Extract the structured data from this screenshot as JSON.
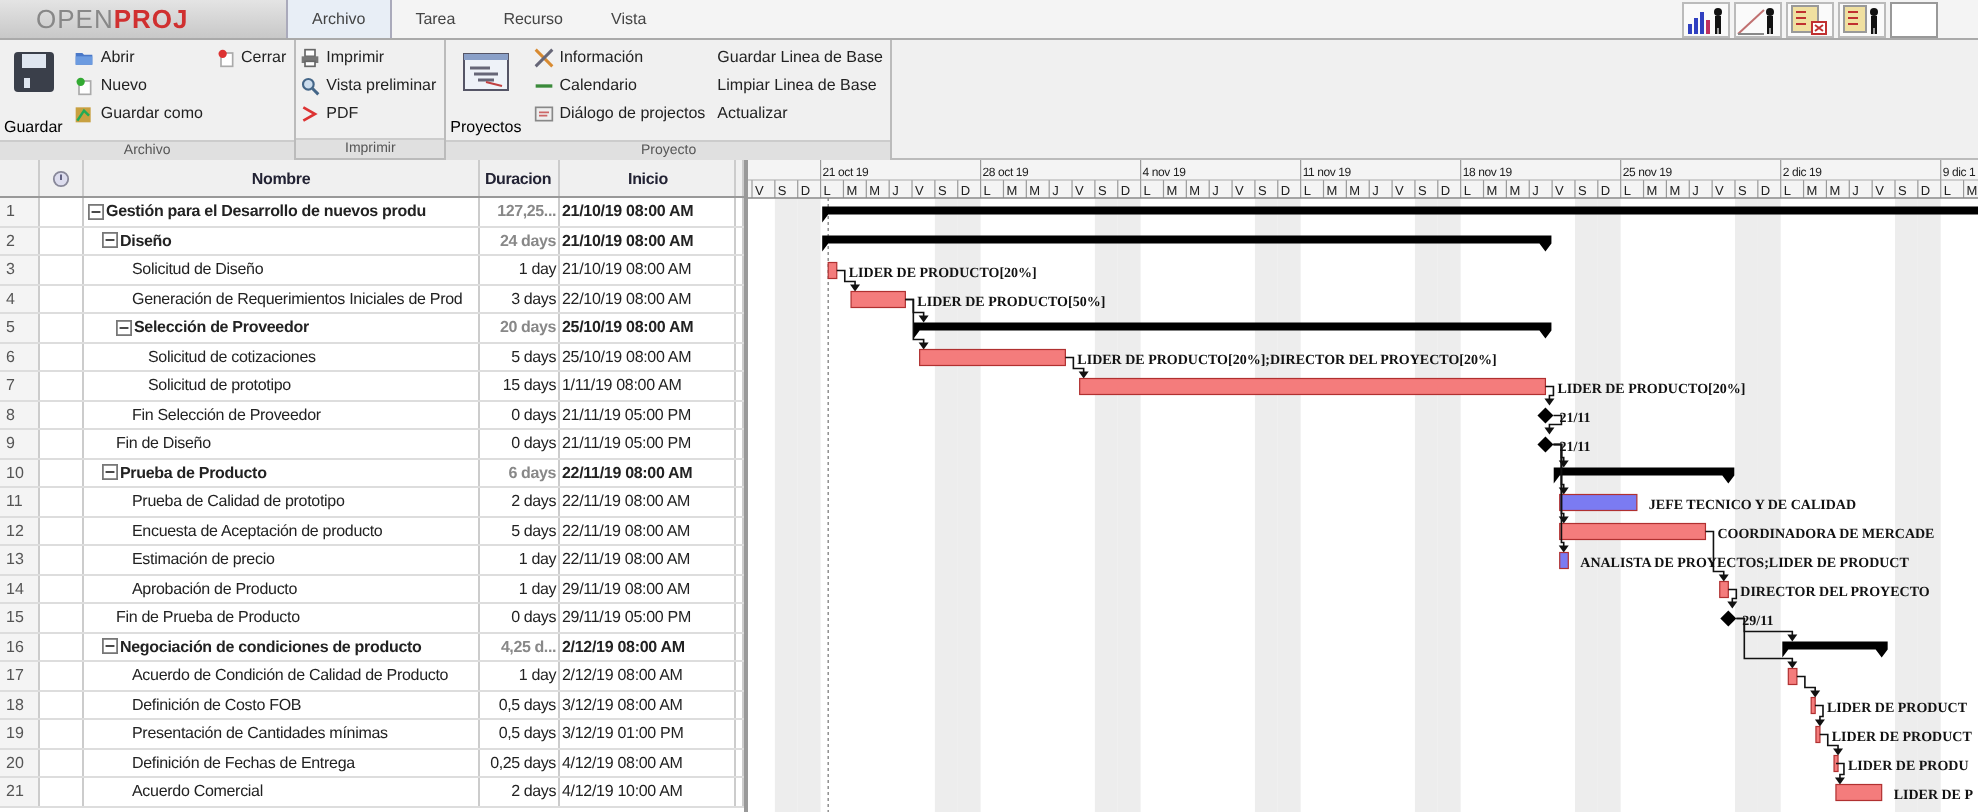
{
  "logo": {
    "part_1": "OPEN",
    "part_2": "PROJ"
  },
  "tabs": [
    {
      "label": "Archivo",
      "selected": true
    },
    {
      "label": "Tarea",
      "selected": false
    },
    {
      "label": "Recurso",
      "selected": false
    },
    {
      "label": "Vista",
      "selected": false
    }
  ],
  "ribbon": [
    {
      "label": "Archivo",
      "columns": [
        [
          {
            "label": "Guardar",
            "kind": "large"
          }
        ],
        [
          {
            "label": "Abrir",
            "kind": "small"
          },
          {
            "label": "Nuevo",
            "kind": "small"
          },
          {
            "label": "Guardar como",
            "kind": "small"
          }
        ],
        [
          {
            "label": "Cerrar",
            "kind": "small"
          }
        ]
      ]
    },
    {
      "label": "Imprimir",
      "columns": [
        [
          {
            "label": "Imprimir",
            "kind": "small"
          },
          {
            "label": "Vista preliminar",
            "kind": "small"
          },
          {
            "label": "PDF",
            "kind": "small"
          }
        ]
      ]
    },
    {
      "label": "Proyecto",
      "columns": [
        [
          {
            "label": "Proyectos",
            "kind": "large"
          }
        ],
        [
          {
            "label": "Información",
            "kind": "small"
          },
          {
            "label": "Calendario",
            "kind": "small"
          },
          {
            "label": "Diálogo de projectos",
            "kind": "small"
          }
        ],
        [
          {
            "label": "Guardar Linea de Base",
            "kind": "small"
          },
          {
            "label": "Limpiar Linea de Base",
            "kind": "small"
          },
          {
            "label": "Actualizar",
            "kind": "small"
          }
        ]
      ]
    }
  ],
  "table": {
    "columns": [
      "Nombre",
      "Duracion",
      "Inicio"
    ]
  },
  "tasks": [
    {
      "num": "1",
      "name": "Gestión para el Desarrollo de nuevos produ",
      "duration": "127,25...",
      "start": "21/10/19 08:00 AM",
      "expanded": true,
      "bar": {
        "kind": "summary"
      },
      "children": [
        {
          "num": "2",
          "name": "Diseño",
          "duration": "24 days",
          "start": "21/10/19 08:00 AM",
          "expanded": true,
          "bar": {
            "kind": "summary"
          },
          "children": [
            {
              "num": "3",
              "name": "Solicitud de Diseño",
              "duration": "1 day",
              "start": "21/10/19 08:00 AM",
              "bar": {
                "kind": "task",
                "color": "#f47c7c",
                "label": "LIDER DE PRODUCTO[20%]"
              }
            },
            {
              "num": "4",
              "name": "Generación de Requerimientos Iniciales de Prod",
              "duration": "3 days",
              "start": "22/10/19 08:00 AM",
              "bar": {
                "kind": "task",
                "color": "#f47c7c",
                "label": "LIDER DE PRODUCTO[50%]",
                "linked": true
              }
            },
            {
              "num": "5",
              "name": "Selección de Proveedor",
              "duration": "20 days",
              "start": "25/10/19 08:00 AM",
              "expanded": true,
              "bar": {
                "kind": "summary",
                "linked": true
              },
              "children": [
                {
                  "num": "6",
                  "name": "Solicitud de cotizaciones",
                  "duration": "5 days",
                  "start": "25/10/19 08:00 AM",
                  "bar": {
                    "kind": "task",
                    "color": "#f47c7c",
                    "label": "LIDER DE PRODUCTO[20%];DIRECTOR DEL PROYECTO[20%]",
                    "linked": true
                  }
                },
                {
                  "num": "7",
                  "name": "Solicitud de prototipo",
                  "duration": "15 days",
                  "start": "1/11/19 08:00 AM",
                  "bar": {
                    "kind": "task",
                    "color": "#f47c7c",
                    "label": "LIDER DE PRODUCTO[20%]",
                    "linked": true
                  }
                }
              ]
            },
            {
              "num": "8",
              "name": "Fin Selección de Proveedor",
              "duration": "0 days",
              "start": "21/11/19 05:00 PM",
              "bar": {
                "kind": "milestone",
                "label": "21/11",
                "linked": true
              }
            }
          ]
        },
        {
          "num": "9",
          "name": "Fin de Diseño",
          "duration": "0 days",
          "start": "21/11/19 05:00 PM",
          "bar": {
            "kind": "milestone",
            "label": "21/11",
            "linked": true
          }
        },
        {
          "num": "10",
          "name": "Prueba de Producto",
          "duration": "6 days",
          "start": "22/11/19 08:00 AM",
          "expanded": true,
          "bar": {
            "kind": "summary",
            "linked": true
          },
          "children": [
            {
              "num": "11",
              "name": "Prueba de Calidad de prototipo",
              "duration": "2 days",
              "start": "22/11/19 08:00 AM",
              "bar": {
                "kind": "task",
                "color": "#7b7bf2",
                "label": "JEFE TECNICO Y DE CALIDAD",
                "linked": true
              }
            },
            {
              "num": "12",
              "name": "Encuesta de Aceptación de producto",
              "duration": "5 days",
              "start": "22/11/19 08:00 AM",
              "bar": {
                "kind": "task",
                "color": "#f47c7c",
                "label": "COORDINADORA DE MERCADE",
                "linked": true
              }
            },
            {
              "num": "13",
              "name": "Estimación de precio",
              "duration": "1 day",
              "start": "22/11/19 08:00 AM",
              "bar": {
                "kind": "task",
                "color": "#7b7bf2",
                "label": "ANALISTA DE PROYECTOS;LIDER DE PRODUCT",
                "linked": true
              }
            },
            {
              "num": "14",
              "name": "Aprobación de Producto",
              "duration": "1 day",
              "start": "29/11/19 08:00 AM",
              "bar": {
                "kind": "task",
                "color": "#f47c7c",
                "label": "DIRECTOR DEL PROYECTO",
                "linked": true
              }
            }
          ]
        },
        {
          "num": "15",
          "name": "Fin de Prueba de Producto",
          "duration": "0 days",
          "start": "29/11/19 05:00 PM",
          "bar": {
            "kind": "milestone",
            "label": "29/11",
            "linked": true
          }
        },
        {
          "num": "16",
          "name": "Negociación de condiciones de producto",
          "duration": "4,25 d...",
          "start": "2/12/19 08:00 AM",
          "expanded": true,
          "bar": {
            "kind": "summary",
            "linked": true
          },
          "children": [
            {
              "num": "17",
              "name": "Acuerdo de Condición de Calidad de Producto",
              "duration": "1 day",
              "start": "2/12/19 08:00 AM",
              "bar": {
                "kind": "task",
                "color": "#f47c7c",
                "linked": true
              }
            },
            {
              "num": "18",
              "name": "Definición de Costo FOB",
              "duration": "0,5 days",
              "start": "3/12/19 08:00 AM",
              "bar": {
                "kind": "task",
                "color": "#f47c7c",
                "label": "LIDER DE PRODUCT",
                "linked": true
              }
            },
            {
              "num": "19",
              "name": "Presentación de Cantidades mínimas",
              "duration": "0,5 days",
              "start": "3/12/19 01:00 PM",
              "bar": {
                "kind": "task",
                "color": "#f47c7c",
                "label": "LIDER DE PRODUCT",
                "linked": true
              }
            },
            {
              "num": "20",
              "name": "Definición de Fechas de Entrega",
              "duration": "0,25 days",
              "start": "4/12/19 08:00 AM",
              "bar": {
                "kind": "task",
                "color": "#f47c7c",
                "label": "LIDER DE PRODU",
                "linked": true
              }
            },
            {
              "num": "21",
              "name": "Acuerdo Comercial",
              "duration": "2 days",
              "start": "4/12/19 10:00 AM",
              "bar": {
                "kind": "task",
                "color": "#f47c7c",
                "label": "LIDER DE P",
                "linked": true
              }
            }
          ]
        }
      ]
    }
  ],
  "gantt": {
    "weeks": [
      "21 oct 19",
      "28 oct 19",
      "4 nov 19",
      "11 nov 19",
      "18 nov 19",
      "25 nov 19",
      "2 dic 19",
      "9 dic 1"
    ],
    "days": [
      "V",
      "S",
      "D",
      "L",
      "M",
      "M",
      "J",
      "V",
      "S",
      "D",
      "L",
      "M",
      "M",
      "J",
      "V",
      "S",
      "D",
      "L",
      "M",
      "M",
      "J",
      "V",
      "S",
      "D",
      "L",
      "M",
      "M",
      "J",
      "V",
      "S",
      "D",
      "L",
      "M",
      "M",
      "J",
      "V",
      "S",
      "D",
      "L",
      "M",
      "M",
      "J",
      "V",
      "S",
      "D",
      "L",
      "M",
      "M",
      "J",
      "V",
      "S",
      "D",
      "L",
      "M"
    ]
  }
}
